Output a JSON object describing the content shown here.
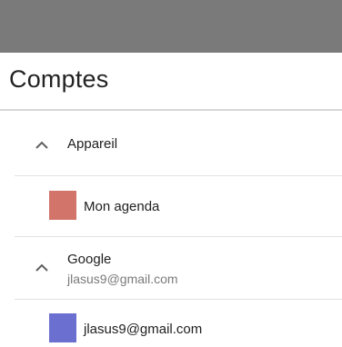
{
  "header": {
    "title": "Comptes"
  },
  "accounts": [
    {
      "name": "Appareil",
      "email": "",
      "expanded": true,
      "icon": "chevron-up-icon",
      "calendars": [
        {
          "label": "Mon agenda",
          "color": "#d2746a"
        }
      ]
    },
    {
      "name": "Google",
      "email": "jlasus9@gmail.com",
      "expanded": true,
      "icon": "chevron-up-icon",
      "calendars": [
        {
          "label": "jlasus9@gmail.com",
          "color": "#6b6fd0"
        }
      ]
    }
  ]
}
